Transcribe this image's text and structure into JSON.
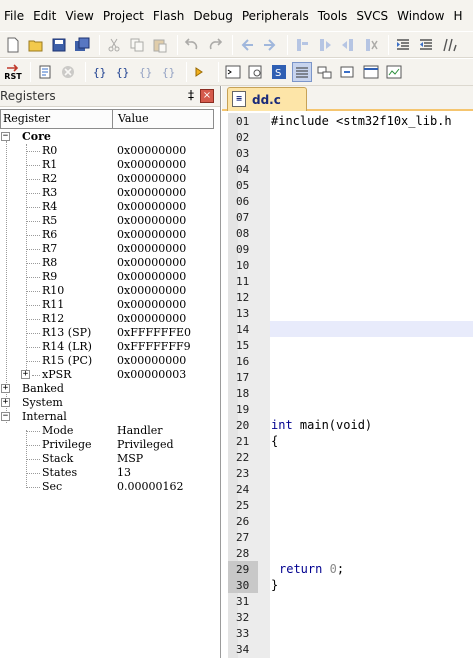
{
  "menu": [
    "File",
    "Edit",
    "View",
    "Project",
    "Flash",
    "Debug",
    "Peripherals",
    "Tools",
    "SVCS",
    "Window",
    "H"
  ],
  "toolbar1": [
    "new-file-icon",
    "open-folder-icon",
    "save-icon",
    "save-all-icon",
    "cut-icon",
    "copy-icon",
    "paste-icon",
    "undo-icon",
    "redo-icon",
    "back-icon",
    "forward-icon",
    "bookmark-icon",
    "bookmark-prev-icon",
    "bookmark-next-icon",
    "bookmark-clear-icon",
    "indent-icon",
    "unindent-icon",
    "comment-icon"
  ],
  "toolbar2": {
    "reset_label": "RST",
    "icons": [
      "reset-icon",
      "run-icon",
      "stop-icon",
      "step-into-icon",
      "step-over-icon",
      "step-out-icon",
      "run-to-cursor-icon",
      "show-next-statement-icon",
      "command-window-icon",
      "disassembly-window-icon",
      "symbols-window-icon",
      "registers-window-icon",
      "call-stack-icon",
      "watch-window-icon",
      "memory-window-icon",
      "serial-window-icon"
    ]
  },
  "registers_panel": {
    "title": "Registers",
    "pin": "‡",
    "close": "×",
    "columns": [
      "Register",
      "Value"
    ],
    "core_label": "Core",
    "core": [
      {
        "name": "R0",
        "value": "0x00000000"
      },
      {
        "name": "R1",
        "value": "0x00000000"
      },
      {
        "name": "R2",
        "value": "0x00000000"
      },
      {
        "name": "R3",
        "value": "0x00000000"
      },
      {
        "name": "R4",
        "value": "0x00000000"
      },
      {
        "name": "R5",
        "value": "0x00000000"
      },
      {
        "name": "R6",
        "value": "0x00000000"
      },
      {
        "name": "R7",
        "value": "0x00000000"
      },
      {
        "name": "R8",
        "value": "0x00000000"
      },
      {
        "name": "R9",
        "value": "0x00000000"
      },
      {
        "name": "R10",
        "value": "0x00000000"
      },
      {
        "name": "R11",
        "value": "0x00000000"
      },
      {
        "name": "R12",
        "value": "0x00000000"
      },
      {
        "name": "R13 (SP)",
        "value": "0xFFFFFFE0"
      },
      {
        "name": "R14 (LR)",
        "value": "0xFFFFFFF9"
      },
      {
        "name": "R15 (PC)",
        "value": "0x00000000"
      },
      {
        "name": "xPSR",
        "value": "0x00000003"
      }
    ],
    "groups": [
      "Banked",
      "System",
      "Internal"
    ],
    "internal": [
      {
        "name": "Mode",
        "value": "Handler"
      },
      {
        "name": "Privilege",
        "value": "Privileged"
      },
      {
        "name": "Stack",
        "value": "MSP"
      },
      {
        "name": "States",
        "value": "13"
      },
      {
        "name": "Sec",
        "value": "0.00000162"
      }
    ]
  },
  "editor": {
    "tab_label": "dd.c",
    "line_numbers": [
      "01",
      "02",
      "03",
      "04",
      "05",
      "06",
      "07",
      "08",
      "09",
      "10",
      "11",
      "12",
      "13",
      "14",
      "15",
      "16",
      "17",
      "18",
      "19",
      "20",
      "21",
      "22",
      "23",
      "24",
      "25",
      "26",
      "27",
      "28",
      "29",
      "30",
      "31",
      "32",
      "33",
      "34"
    ],
    "highlighted_line": "14",
    "breakpoint_lines": [
      "29",
      "30"
    ],
    "code": {
      "line01": "#include <stm32f10x_lib.h",
      "line20_kw": "int",
      "line20_rest": " main(void)",
      "line21": "{",
      "line29_kw": "return",
      "line29_num": "0",
      "line29_end": ";",
      "line30": "}"
    }
  },
  "colors": {
    "accent_tab": "#fde5a8",
    "highlight_line": "#e8ebfb",
    "keyword": "#00008f"
  }
}
